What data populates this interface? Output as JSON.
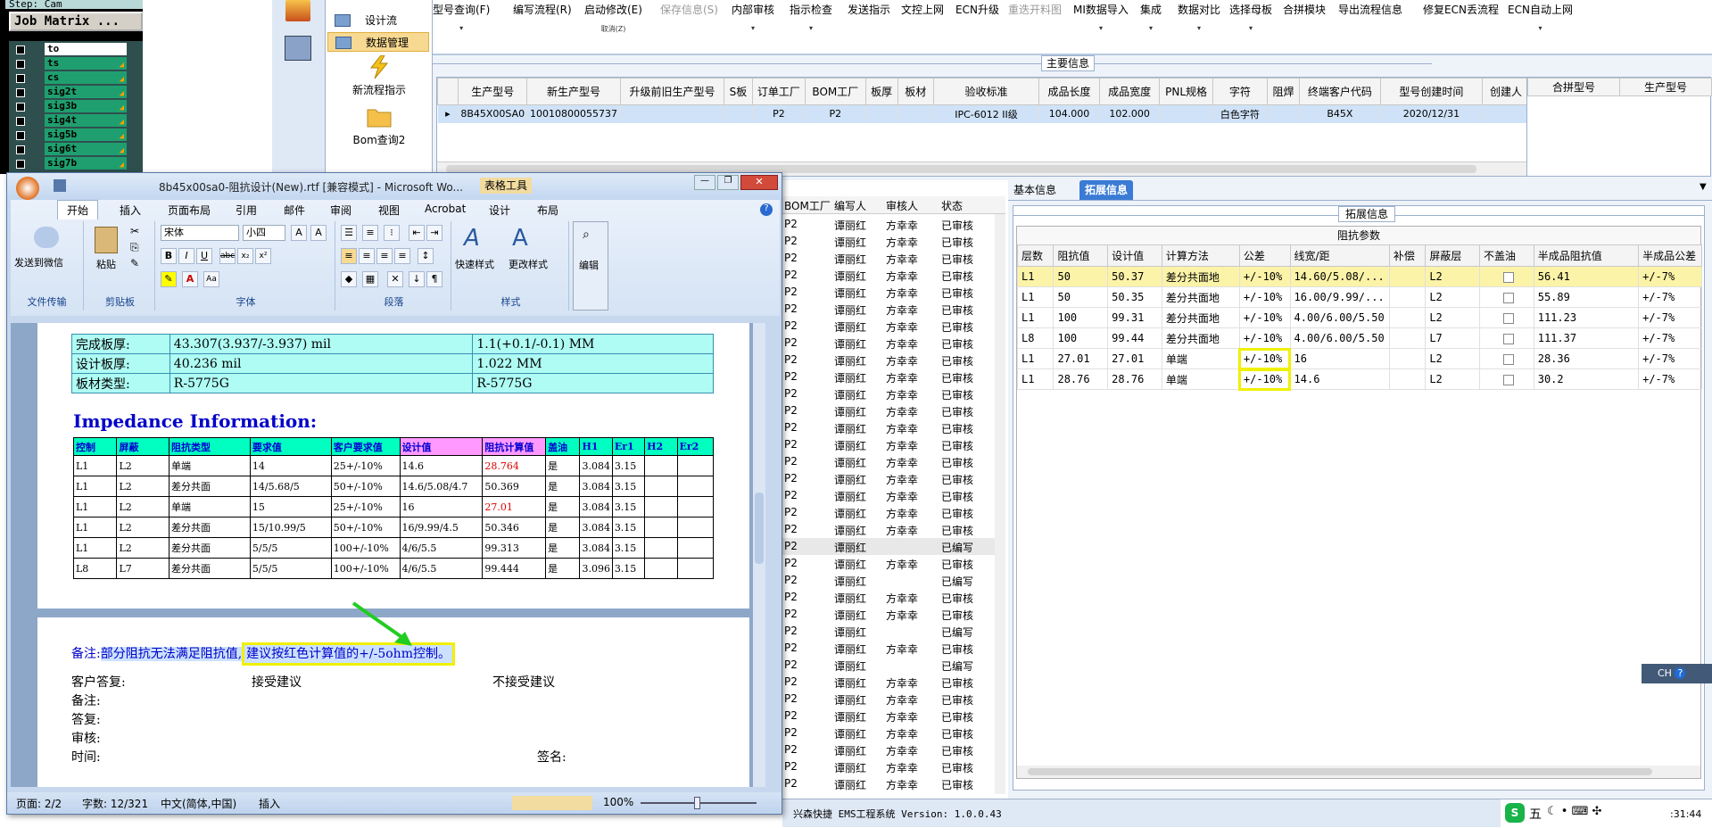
{
  "genesis": {
    "step_label": "Step: Cam",
    "job_matrix": "Job Matrix ...",
    "layers": [
      {
        "name": "to",
        "white": true
      },
      {
        "name": "ts",
        "white": false
      },
      {
        "name": "cs",
        "white": false
      },
      {
        "name": "sig2t",
        "white": false
      },
      {
        "name": "sig3b",
        "white": false
      },
      {
        "name": "sig4t",
        "white": false
      },
      {
        "name": "sig5b",
        "white": false
      },
      {
        "name": "sig6t",
        "white": false
      },
      {
        "name": "sig7b",
        "white": false
      }
    ]
  },
  "nav": {
    "items": [
      "设计流",
      "数据管理"
    ],
    "big_items": [
      "新流程指示",
      "Bom查询2"
    ]
  },
  "toolbar": {
    "items": [
      {
        "label": "型号查询(F)",
        "dd": "▾"
      },
      {
        "label": "编写流程(R)",
        "dd": ""
      },
      {
        "label": "启动修改(E)",
        "dd": "取消(Z)"
      },
      {
        "label": "保存信息(S)",
        "dd": "",
        "disabled": true
      },
      {
        "label": "内部审核",
        "dd": "▾"
      },
      {
        "label": "指示检查",
        "dd": "▾"
      },
      {
        "label": "发送指示",
        "dd": ""
      },
      {
        "label": "文控上网",
        "dd": ""
      },
      {
        "label": "ECN升级",
        "dd": ""
      },
      {
        "label": "重迭开料图",
        "dd": "",
        "disabled": true
      },
      {
        "label": "MI数据导入",
        "dd": "▾"
      },
      {
        "label": "集成",
        "dd": "▾"
      },
      {
        "label": "数据对比",
        "dd": "▾"
      },
      {
        "label": "选择母板",
        "dd": "▾"
      },
      {
        "label": "合拼模块",
        "dd": ""
      },
      {
        "label": "导出流程信息",
        "dd": ""
      },
      {
        "label": "修复ECN丢流程",
        "dd": ""
      },
      {
        "label": "ECN自动上网",
        "dd": "▾"
      }
    ]
  },
  "main_info": {
    "title": "主要信息",
    "headers": [
      "生产型号",
      "新生产型号",
      "升级前旧生产型号",
      "S板",
      "订单工厂",
      "BOM工厂",
      "板厚",
      "板材",
      "验收标准",
      "成品长度",
      "成品宽度",
      "PNL规格",
      "字符",
      "阻焊",
      "终端客户代码",
      "型号创建时间",
      "创建人"
    ],
    "row": [
      "8B45X00SA0",
      "10010800055737",
      "",
      "",
      "P2",
      "P2",
      "",
      "",
      "IPC-6012 II级",
      "104.000",
      "102.000",
      "",
      "白色字符",
      "",
      "B45X",
      "2020/12/31",
      ""
    ],
    "side_headers": [
      "合拼型号",
      "生产型号"
    ]
  },
  "word": {
    "title": "8b45x00sa0-阻抗设计(New).rtf [兼容模式] - Microsoft Wo...",
    "context_tab": "表格工具",
    "tabs": [
      "开始",
      "插入",
      "页面布局",
      "引用",
      "邮件",
      "审阅",
      "视图",
      "Acrobat",
      "设计",
      "布局"
    ],
    "groups": [
      "文件传输",
      "剪贴板",
      "字体",
      "段落",
      "样式"
    ],
    "send_wechat": "发送到微信",
    "paste": "粘贴",
    "font_name": "宋体",
    "font_size": "小四",
    "quick_style": "快速样式",
    "change_style": "更改样式",
    "edit": "编辑",
    "info_rows": [
      [
        "完成板厚:",
        "43.307(3.937/-3.937) mil",
        "1.1(+0.1/-0.1) MM"
      ],
      [
        "设计板厚:",
        "40.236 mil",
        "1.022 MM"
      ],
      [
        "板材类型:",
        "R-5775G",
        "R-5775G"
      ]
    ],
    "imp_title": "Impedance Information:",
    "imp_headers": [
      "控制",
      "屏蔽",
      "阻抗类型",
      "要求值",
      "客户要求值",
      "设计值",
      "阻抗计算值",
      "盖油",
      "H1",
      "Er1",
      "H2",
      "Er2"
    ],
    "imp_rows": [
      [
        "L1",
        "L2",
        "单端",
        "14",
        "25+/-10%",
        "14.6",
        "28.764",
        "是",
        "3.084",
        "3.15",
        "",
        ""
      ],
      [
        "L1",
        "L2",
        "差分共面",
        "14/5.68/5",
        "50+/-10%",
        "14.6/5.08/4.7",
        "50.369",
        "是",
        "3.084",
        "3.15",
        "",
        ""
      ],
      [
        "L1",
        "L2",
        "单端",
        "15",
        "25+/-10%",
        "16",
        "27.01",
        "是",
        "3.084",
        "3.15",
        "",
        ""
      ],
      [
        "L1",
        "L2",
        "差分共面",
        "15/10.99/5",
        "50+/-10%",
        "16/9.99/4.5",
        "50.346",
        "是",
        "3.084",
        "3.15",
        "",
        ""
      ],
      [
        "L1",
        "L2",
        "差分共面",
        "5/5/5",
        "100+/-10%",
        "4/6/5.5",
        "99.313",
        "是",
        "3.084",
        "3.15",
        "",
        ""
      ],
      [
        "L8",
        "L7",
        "差分共面",
        "5/5/5",
        "100+/-10%",
        "4/6/5.5",
        "99.444",
        "是",
        "3.096",
        "3.15",
        "",
        ""
      ]
    ],
    "note_label": "备注:",
    "note_text": "部分阻抗无法满足阻抗值,",
    "note_highlight": "建议按红色计算值的+/-5ohm控制。",
    "reply_rows": [
      "客户答复:",
      "备注:",
      "答复:",
      "审核:",
      "时间:"
    ],
    "accept": "接受建议",
    "reject": "不接受建议",
    "sign": "签名:",
    "status": {
      "page": "页面: 2/2",
      "words": "字数: 12/321",
      "lang": "中文(简体,中国)",
      "mode": "插入",
      "zoom": "100%"
    }
  },
  "midlist": {
    "headers": [
      "BOM工厂",
      "编写人",
      "审核人",
      "状态"
    ],
    "rows": [
      [
        "P2",
        "谭丽红",
        "方幸幸",
        "已审核"
      ],
      [
        "P2",
        "谭丽红",
        "方幸幸",
        "已审核"
      ],
      [
        "P2",
        "谭丽红",
        "方幸幸",
        "已审核"
      ],
      [
        "P2",
        "谭丽红",
        "方幸幸",
        "已审核"
      ],
      [
        "P2",
        "谭丽红",
        "方幸幸",
        "已审核"
      ],
      [
        "P2",
        "谭丽红",
        "方幸幸",
        "已审核"
      ],
      [
        "P2",
        "谭丽红",
        "方幸幸",
        "已审核"
      ],
      [
        "P2",
        "谭丽红",
        "方幸幸",
        "已审核"
      ],
      [
        "P2",
        "谭丽红",
        "方幸幸",
        "已审核"
      ],
      [
        "P2",
        "谭丽红",
        "方幸幸",
        "已审核"
      ],
      [
        "P2",
        "谭丽红",
        "方幸幸",
        "已审核"
      ],
      [
        "P2",
        "谭丽红",
        "方幸幸",
        "已审核"
      ],
      [
        "P2",
        "谭丽红",
        "方幸幸",
        "已审核"
      ],
      [
        "P2",
        "谭丽红",
        "方幸幸",
        "已审核"
      ],
      [
        "P2",
        "谭丽红",
        "方幸幸",
        "已审核"
      ],
      [
        "P2",
        "谭丽红",
        "方幸幸",
        "已审核"
      ],
      [
        "P2",
        "谭丽红",
        "方幸幸",
        "已审核"
      ],
      [
        "P2",
        "谭丽红",
        "方幸幸",
        "已审核"
      ],
      [
        "P2",
        "谭丽红",
        "方幸幸",
        "已审核"
      ],
      [
        "P2",
        "谭丽红",
        "",
        "已编写"
      ],
      [
        "P2",
        "谭丽红",
        "方幸幸",
        "已审核"
      ],
      [
        "P2",
        "谭丽红",
        "",
        "已编写"
      ],
      [
        "P2",
        "谭丽红",
        "方幸幸",
        "已审核"
      ],
      [
        "P2",
        "谭丽红",
        "方幸幸",
        "已审核"
      ],
      [
        "P2",
        "谭丽红",
        "",
        "已编写"
      ],
      [
        "P2",
        "谭丽红",
        "方幸幸",
        "已审核"
      ],
      [
        "P2",
        "谭丽红",
        "",
        "已编写"
      ],
      [
        "P2",
        "谭丽红",
        "方幸幸",
        "已审核"
      ],
      [
        "P2",
        "谭丽红",
        "方幸幸",
        "已审核"
      ],
      [
        "P2",
        "谭丽红",
        "方幸幸",
        "已审核"
      ],
      [
        "P2",
        "谭丽红",
        "方幸幸",
        "已审核"
      ],
      [
        "P2",
        "谭丽红",
        "方幸幸",
        "已审核"
      ],
      [
        "P2",
        "谭丽红",
        "方幸幸",
        "已审核"
      ],
      [
        "P2",
        "谭丽红",
        "方幸幸",
        "已审核"
      ]
    ]
  },
  "right": {
    "tabs": [
      "基本信息",
      "拓展信息"
    ],
    "section": "拓展信息",
    "sub": "阻抗参数",
    "headers": [
      "层数",
      "阻抗值",
      "设计值",
      "计算方法",
      "公差",
      "线宽/距",
      "补偿",
      "屏蔽层",
      "不盖油",
      "半成品阻抗值",
      "半成品公差"
    ],
    "rows": [
      [
        "L1",
        "50",
        "50.37",
        "差分共面地",
        "+/-10%",
        "14.60/5.08/...",
        "",
        "L2",
        "",
        "56.41",
        "+/-7%"
      ],
      [
        "L1",
        "50",
        "50.35",
        "差分共面地",
        "+/-10%",
        "16.00/9.99/...",
        "",
        "L2",
        "",
        "55.89",
        "+/-7%"
      ],
      [
        "L1",
        "100",
        "99.31",
        "差分共面地",
        "+/-10%",
        "4.00/6.00/5.50",
        "",
        "L2",
        "",
        "111.23",
        "+/-7%"
      ],
      [
        "L8",
        "100",
        "99.44",
        "差分共面地",
        "+/-10%",
        "4.00/6.00/5.50",
        "",
        "L7",
        "",
        "111.37",
        "+/-7%"
      ],
      [
        "L1",
        "27.01",
        "27.01",
        "单端",
        "+/-10%",
        "16",
        "",
        "L2",
        "",
        "28.36",
        "+/-7%"
      ],
      [
        "L1",
        "28.76",
        "28.76",
        "单端",
        "+/-10%",
        "14.6",
        "",
        "L2",
        "",
        "30.2",
        "+/-7%"
      ]
    ]
  },
  "statusbar": {
    "version": "兴森快捷 EMS工程系统 Version: 1.0.0.43",
    "ime": "CH",
    "ime2": "五",
    "clock": ":31:44"
  },
  "colors": {
    "highlight": "#f0f000",
    "arrow": "#22cc22",
    "red": "#e00000",
    "blue": "#0000c8"
  }
}
